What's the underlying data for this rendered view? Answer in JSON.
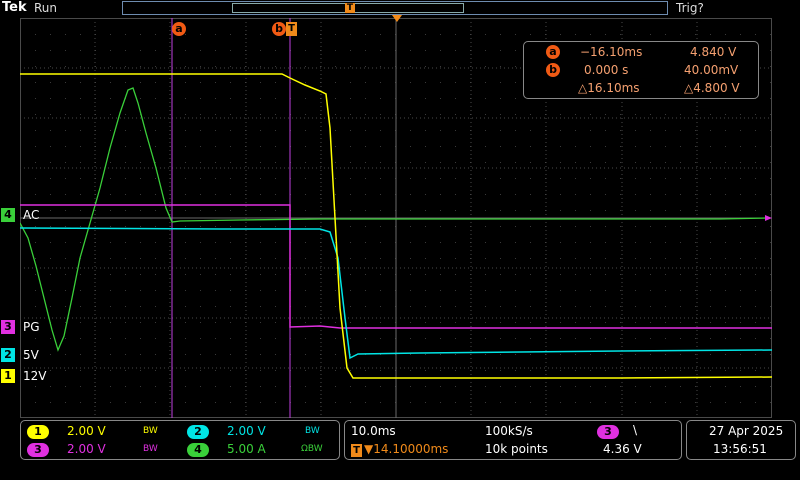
{
  "header": {
    "brand": "Tek",
    "run_state": "Run",
    "trigger_state": "Trig?",
    "trigger_marker": "T"
  },
  "cursors": {
    "a_label": "a",
    "b_label": "b",
    "a_time": "−16.10ms",
    "a_volt": "4.840 V",
    "b_time": "0.000 s",
    "b_volt": "40.00mV",
    "delta_time": "△16.10ms",
    "delta_volt": "△4.800 V"
  },
  "channels": [
    {
      "num": "1",
      "label": "12V",
      "color": "#ffff00"
    },
    {
      "num": "2",
      "label": "5V",
      "color": "#00e5e5"
    },
    {
      "num": "3",
      "label": "PG",
      "color": "#e030e0"
    },
    {
      "num": "4",
      "label": "AC",
      "color": "#3ad03a"
    }
  ],
  "vertical": {
    "ch1": {
      "num": "1",
      "scale": "2.00 V",
      "bw": "BW"
    },
    "ch2": {
      "num": "2",
      "scale": "2.00 V",
      "bw": "BW"
    },
    "ch3": {
      "num": "3",
      "scale": "2.00 V",
      "bw": "BW"
    },
    "ch4": {
      "num": "4",
      "scale": "5.00 A",
      "bw": "ΩBW"
    }
  },
  "horizontal": {
    "timebase": "10.0ms",
    "sample_rate": "100kS/s",
    "trigger_position": "▼14.10000ms",
    "record_length": "10k points",
    "trigger_marker": "T"
  },
  "trigger": {
    "source": "3",
    "slope": "\\",
    "level": "4.36 V"
  },
  "datetime": {
    "date": "27 Apr  2025",
    "time": "13:56:51"
  },
  "colors": {
    "ch1": "#ffff00",
    "ch2": "#00e5e5",
    "ch3": "#e030e0",
    "ch4": "#3ad03a",
    "cursor": "#f05a14",
    "trigger": "#f08a1a",
    "grid": "#4a4a4a"
  }
}
